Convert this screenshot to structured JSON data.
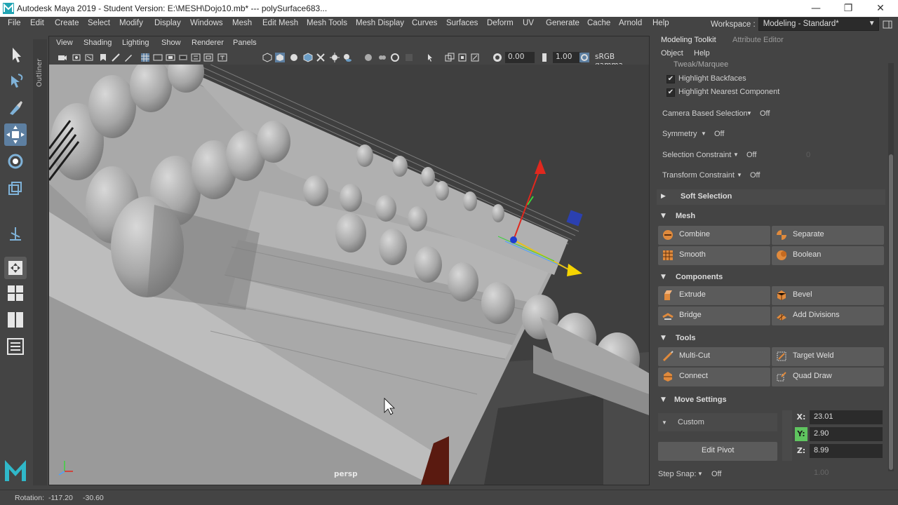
{
  "window": {
    "title": "Autodesk Maya 2019 - Student Version: E:\\MESH\\Dojo10.mb*   ---   polySurface683...",
    "minimize": "—",
    "maximize": "❐",
    "close": "✕"
  },
  "menubar": {
    "items": [
      "File",
      "Edit",
      "Create",
      "Select",
      "Modify",
      "Display",
      "Windows",
      "Mesh",
      "Edit Mesh",
      "Mesh Tools",
      "Mesh Display",
      "Curves",
      "Surfaces",
      "Deform",
      "UV",
      "Generate",
      "Cache",
      "Arnold",
      "Help"
    ],
    "workspace_label": "Workspace :",
    "workspace_value": "Modeling - Standard*"
  },
  "outliner_tab": "Outliner",
  "viewport": {
    "menu": [
      "View",
      "Shading",
      "Lighting",
      "Show",
      "Renderer",
      "Panels"
    ],
    "exposure": "0.00",
    "gamma": "1.00",
    "colorspace": "sRGB gamma",
    "camera_label": "persp"
  },
  "right_panel": {
    "tabs": [
      "Modeling Toolkit",
      "Attribute Editor"
    ],
    "menu": [
      "Object",
      "Help"
    ],
    "tweak_label": "Tweak/Marquee",
    "checks": [
      {
        "label": "Highlight Backfaces",
        "checked": true
      },
      {
        "label": "Highlight Nearest Component",
        "checked": true
      }
    ],
    "options": [
      {
        "label": "Camera Based Selection",
        "value": "Off"
      },
      {
        "label": "Symmetry",
        "value": "Off"
      },
      {
        "label": "Selection Constraint",
        "value": "Off",
        "extra": "0"
      },
      {
        "label": "Transform Constraint",
        "value": "Off"
      }
    ],
    "sections": {
      "soft_selection": "Soft Selection",
      "mesh": "Mesh",
      "components": "Components",
      "tools": "Tools",
      "move_settings": "Move Settings"
    },
    "mesh_buttons": [
      "Combine",
      "Separate",
      "Smooth",
      "Boolean"
    ],
    "component_buttons": [
      "Extrude",
      "Bevel",
      "Bridge",
      "Add Divisions"
    ],
    "tool_buttons": [
      "Multi-Cut",
      "Target Weld",
      "Connect",
      "Quad Draw"
    ],
    "move": {
      "mode": "Custom",
      "edit_pivot": "Edit Pivot",
      "x_label": "X:",
      "x": "23.01",
      "y_label": "Y:",
      "y": "2.90",
      "z_label": "Z:",
      "z": "8.99"
    },
    "step_snap_label": "Step Snap:",
    "step_snap_value": "Off",
    "step_snap_amount": "1.00"
  },
  "status": {
    "rotation_label": "Rotation:",
    "rotation_x": "-117.20",
    "rotation_y": "-30.60"
  },
  "colors": {
    "accent": "#5d7fa1",
    "panel_bg": "#444444",
    "field_bg": "#2b2b2b",
    "y_axis_highlight": "#5fc45f"
  }
}
